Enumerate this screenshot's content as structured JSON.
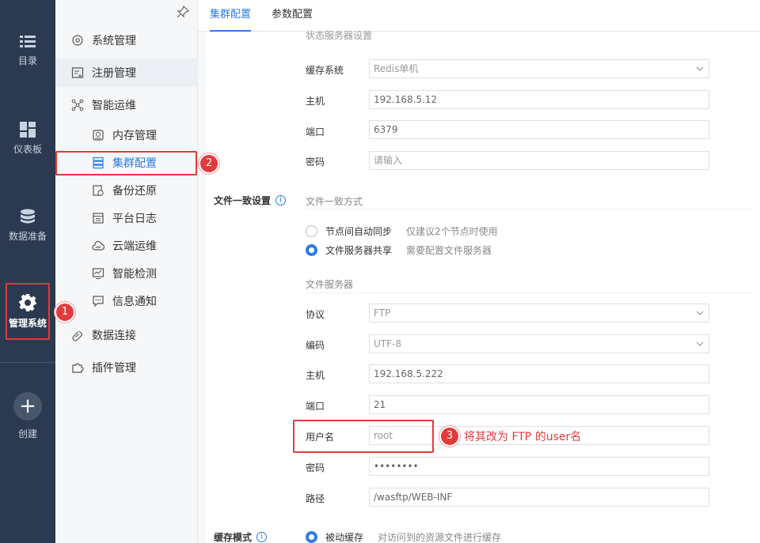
{
  "rail": {
    "items": [
      {
        "label": "目录",
        "icon": "list-icon"
      },
      {
        "label": "仪表板",
        "icon": "dashboard-icon"
      },
      {
        "label": "数据准备",
        "icon": "database-icon"
      },
      {
        "label": "管理系统",
        "icon": "gear-icon"
      },
      {
        "label": "创建",
        "icon": "plus-icon"
      }
    ]
  },
  "nav": {
    "items": [
      {
        "label": "系统管理",
        "icon": "gear-outline-icon"
      },
      {
        "label": "注册管理",
        "icon": "register-icon"
      },
      {
        "label": "智能运维",
        "icon": "network-icon"
      },
      {
        "label": "内存管理",
        "icon": "memory-icon"
      },
      {
        "label": "集群配置",
        "icon": "cluster-icon"
      },
      {
        "label": "备份还原",
        "icon": "backup-icon"
      },
      {
        "label": "平台日志",
        "icon": "log-icon"
      },
      {
        "label": "云端运维",
        "icon": "cloud-icon"
      },
      {
        "label": "智能检测",
        "icon": "monitor-icon"
      },
      {
        "label": "信息通知",
        "icon": "message-icon"
      },
      {
        "label": "数据连接",
        "icon": "link-icon"
      },
      {
        "label": "插件管理",
        "icon": "plugin-icon"
      }
    ]
  },
  "tabs": [
    {
      "label": "集群配置",
      "active": true
    },
    {
      "label": "参数配置",
      "active": false
    }
  ],
  "state_server": {
    "partial_title": "状态服务器设置",
    "cache_system_label": "缓存系统",
    "cache_system_value": "Redis单机",
    "host_label": "主机",
    "host_value": "192.168.5.12",
    "port_label": "端口",
    "port_value": "6379",
    "password_label": "密码",
    "password_placeholder": "请输入"
  },
  "file_consistency": {
    "label": "文件一致设置",
    "mode_title": "文件一致方式",
    "options": [
      {
        "label": "节点间自动同步",
        "hint": "仅建议2个节点时使用",
        "selected": false
      },
      {
        "label": "文件服务器共享",
        "hint": "需要配置文件服务器",
        "selected": true
      }
    ],
    "server_title": "文件服务器",
    "protocol_label": "协议",
    "protocol_value": "FTP",
    "encoding_label": "编码",
    "encoding_value": "UTF-8",
    "host_label": "主机",
    "host_value": "192.168.5.222",
    "port_label": "端口",
    "port_value": "21",
    "username_label": "用户名",
    "username_value": "root",
    "password_label": "密码",
    "password_value": "••••••••",
    "path_label": "路径",
    "path_value": "/wasftp/WEB-INF"
  },
  "cache_mode": {
    "label": "缓存模式",
    "option_label": "被动缓存",
    "option_hint": "对访问到的资源文件进行缓存"
  },
  "annotations": {
    "badge1": "1",
    "badge2": "2",
    "badge3": "3",
    "note3": "将其改为 FTP 的user名"
  },
  "colors": {
    "accent": "#2f7be5",
    "annotation_red": "#e23b3b",
    "rail_bg": "#2b3a50"
  }
}
